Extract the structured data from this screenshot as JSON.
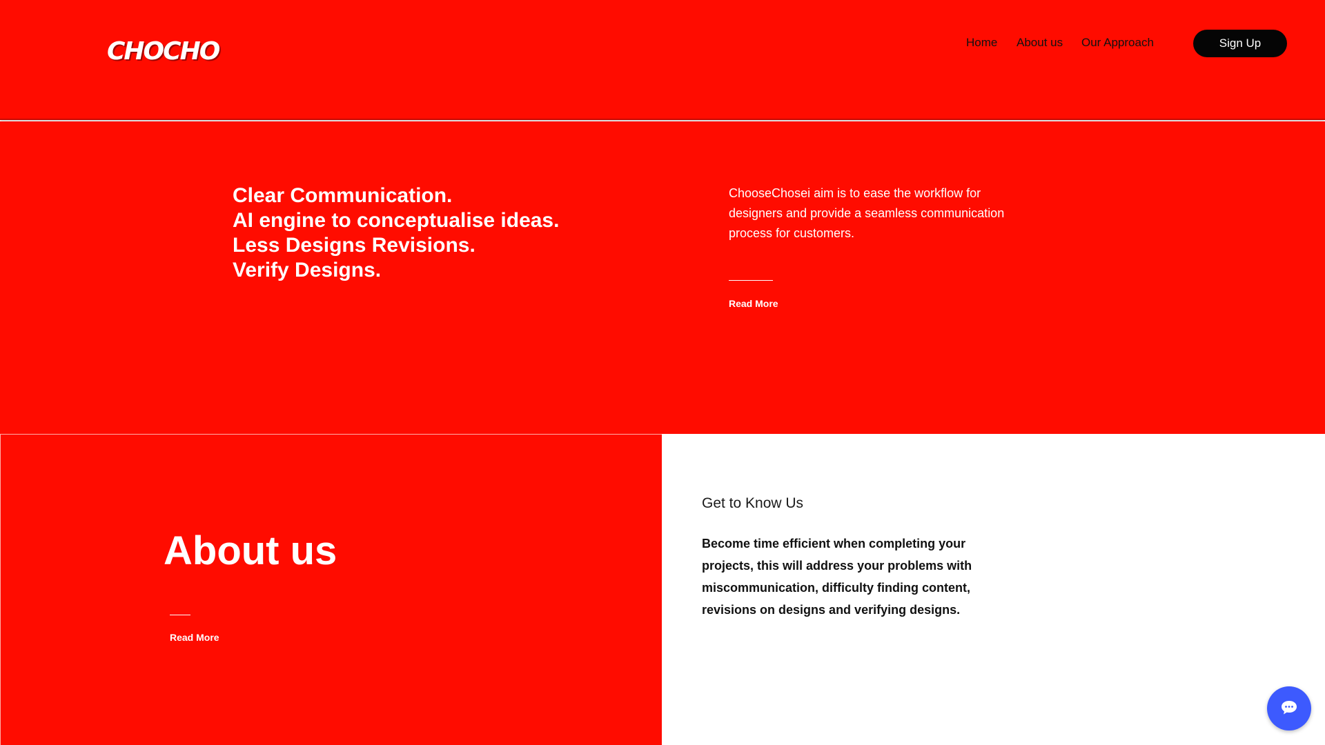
{
  "header": {
    "logo_text": "CHOCHO",
    "nav": [
      {
        "label": "Home"
      },
      {
        "label": "About us"
      },
      {
        "label": "Our Approach"
      }
    ],
    "signup_label": "Sign Up"
  },
  "hero": {
    "lines": [
      "Clear Communication.",
      "AI engine to conceptualise ideas.",
      "Less Designs Revisions.",
      "Verify Designs."
    ],
    "description": "ChooseChosei aim is to ease the workflow for designers and provide a seamless communication process for customers.",
    "read_more_label": "Read More"
  },
  "about": {
    "title": "About us",
    "read_more_label": "Read More",
    "subtitle": "Get to Know Us",
    "body": "Become time efficient when completing your projects, this will address your problems with miscommunication, difficulty finding content, revisions on designs and verifying designs."
  },
  "chat": {
    "icon": "chat-bubble-icon"
  },
  "colors": {
    "brand_red": "#ff0c00",
    "chat_blue": "#3d5afe",
    "button_black": "#050505"
  }
}
